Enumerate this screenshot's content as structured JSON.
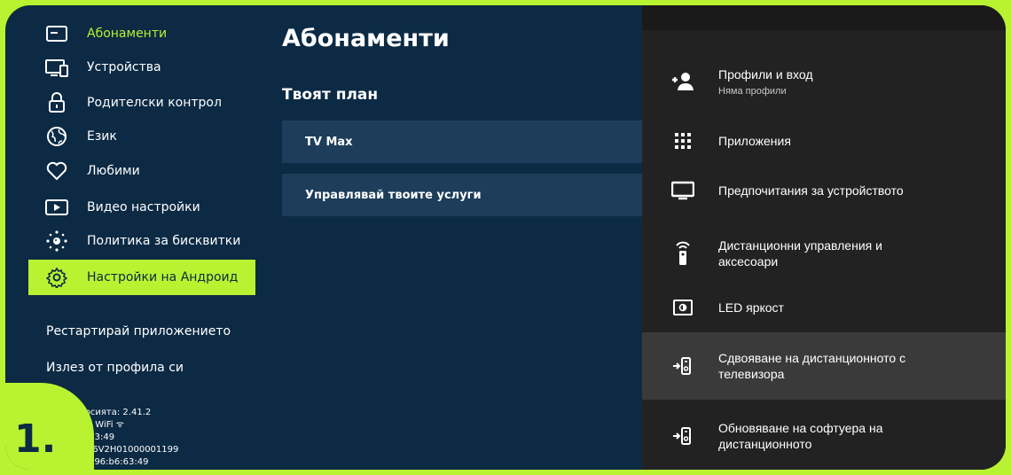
{
  "sidebar": {
    "items": [
      {
        "label": "Абонаменти",
        "icon": "subscriptions-icon"
      },
      {
        "label": "Устройства",
        "icon": "devices-icon"
      },
      {
        "label": "Родителски контрол",
        "icon": "lock-icon"
      },
      {
        "label": "Език",
        "icon": "globe-icon"
      },
      {
        "label": "Любими",
        "icon": "heart-icon"
      },
      {
        "label": "Видео настройки",
        "icon": "play-icon"
      },
      {
        "label": "Политика за бисквитки",
        "icon": "cookie-icon"
      },
      {
        "label": "Настройки на Андроид",
        "icon": "gear-icon"
      }
    ],
    "restart_label": "Рестартирай приложението",
    "logout_label": "Излез от профила си",
    "version_lines": [
      "ер на версията: 2.41.2",
      "връзката: WiFi ᯤ",
      "92:96:b6:63:49",
      "омер: B866V2H01000001199",
      "ess: c0:92:96:b6:63:49"
    ]
  },
  "step_badge": "1.",
  "main": {
    "title": "Абонаменти",
    "plan_heading": "Твоят план",
    "rows": [
      "TV Max",
      "Управлявай твоите услуги"
    ]
  },
  "android_settings": {
    "items": [
      {
        "label": "Профили и вход",
        "sub": "Няма профили",
        "icon": "add-person-icon"
      },
      {
        "label": "Приложения",
        "icon": "apps-grid-icon"
      },
      {
        "label": "Предпочитания за устройството",
        "icon": "tv-icon"
      },
      {
        "label": "Дистанционни управления и",
        "label2": "аксесоари",
        "icon": "remote-icon"
      },
      {
        "label": "LED яркост",
        "icon": "brightness-icon"
      },
      {
        "label": "Сдвояване на дистанционното с",
        "label2": "телевизора",
        "icon": "pair-remote-icon"
      },
      {
        "label": "Обновяване на софтуера на",
        "label2": "дистанционното",
        "icon": "update-remote-icon"
      }
    ]
  },
  "colors": {
    "accent": "#b9f231",
    "background": "#0c2a44",
    "panel": "#222222"
  }
}
